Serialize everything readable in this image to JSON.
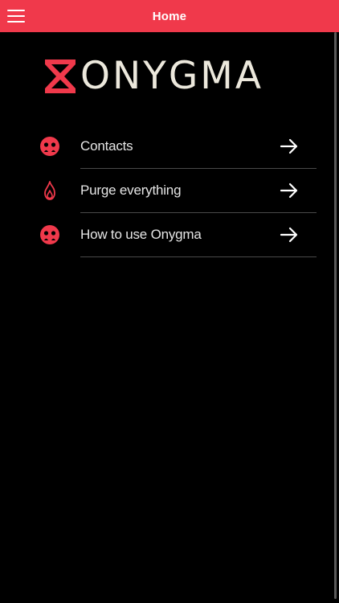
{
  "colors": {
    "accent": "#f0394b",
    "background": "#000000",
    "text": "#e6e6e6",
    "logo_text": "#ece8dc"
  },
  "appbar": {
    "title": "Home",
    "menu_icon": "hamburger-menu-icon"
  },
  "logo": {
    "text": "ONYGMA",
    "mark_icon": "hourglass-icon"
  },
  "menu": {
    "items": [
      {
        "label": "Contacts",
        "icon": "contacts-face-icon",
        "arrow_icon": "arrow-right-icon"
      },
      {
        "label": "Purge everything",
        "icon": "flame-icon",
        "arrow_icon": "arrow-right-icon"
      },
      {
        "label": "How to use Onygma",
        "icon": "help-face-icon",
        "arrow_icon": "arrow-right-icon"
      }
    ]
  }
}
